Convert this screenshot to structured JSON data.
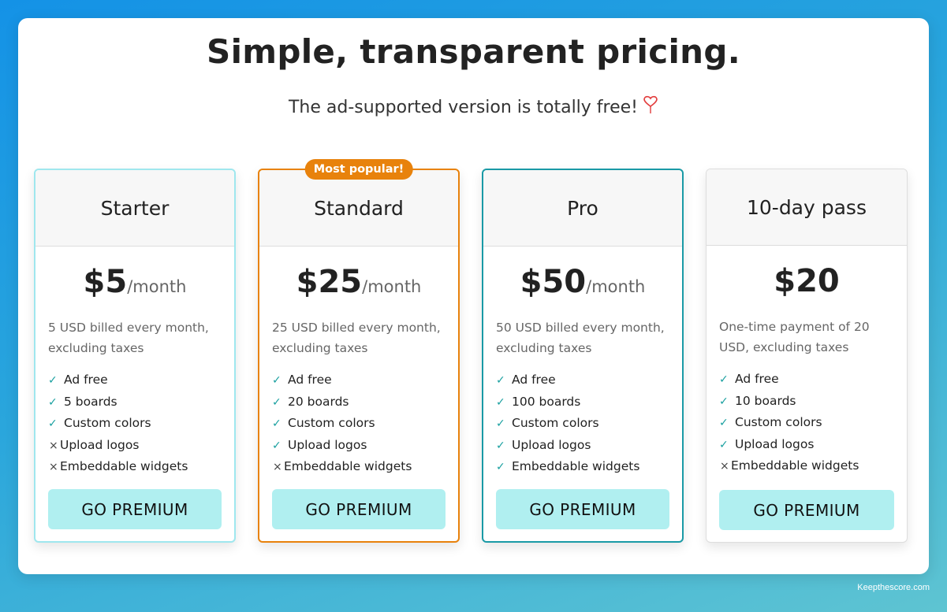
{
  "page": {
    "headline": "Simple, transparent pricing.",
    "subhead": "The ad-supported version is totally free!",
    "watermark": "Keepthescore.com"
  },
  "colors": {
    "starter_border": "#9fe7ee",
    "standard_border": "#e8820c",
    "pro_border": "#1a9aa6",
    "pass_border": "#dddddd",
    "button_bg": "#b0eff0",
    "check": "#1aa0a0",
    "heart": "#e23c3c"
  },
  "plans": [
    {
      "name": "Starter",
      "price": "$5",
      "period": "/month",
      "billing": "5 USD billed every month, excluding taxes",
      "badge": "",
      "features": [
        {
          "label": "Ad free",
          "included": true,
          "icon": "check-icon"
        },
        {
          "label": "5 boards",
          "included": true,
          "icon": "check-icon"
        },
        {
          "label": "Custom colors",
          "included": true,
          "icon": "check-icon"
        },
        {
          "label": "Upload logos",
          "included": false,
          "icon": "cross-icon"
        },
        {
          "label": "Embeddable widgets",
          "included": false,
          "icon": "cross-icon"
        }
      ],
      "cta": "GO PREMIUM"
    },
    {
      "name": "Standard",
      "price": "$25",
      "period": "/month",
      "billing": "25 USD billed every month, excluding taxes",
      "badge": "Most popular!",
      "features": [
        {
          "label": "Ad free",
          "included": true,
          "icon": "check-icon"
        },
        {
          "label": "20 boards",
          "included": true,
          "icon": "check-icon"
        },
        {
          "label": "Custom colors",
          "included": true,
          "icon": "check-icon"
        },
        {
          "label": "Upload logos",
          "included": true,
          "icon": "check-icon"
        },
        {
          "label": "Embeddable widgets",
          "included": false,
          "icon": "cross-icon"
        }
      ],
      "cta": "GO PREMIUM"
    },
    {
      "name": "Pro",
      "price": "$50",
      "period": "/month",
      "billing": "50 USD billed every month, excluding taxes",
      "badge": "",
      "features": [
        {
          "label": "Ad free",
          "included": true,
          "icon": "check-icon"
        },
        {
          "label": "100 boards",
          "included": true,
          "icon": "check-icon"
        },
        {
          "label": "Custom colors",
          "included": true,
          "icon": "check-icon"
        },
        {
          "label": "Upload logos",
          "included": true,
          "icon": "check-icon"
        },
        {
          "label": "Embeddable widgets",
          "included": true,
          "icon": "check-icon"
        }
      ],
      "cta": "GO PREMIUM"
    },
    {
      "name": "10-day pass",
      "price": "$20",
      "period": "",
      "billing": "One-time payment of 20 USD, excluding taxes",
      "badge": "",
      "features": [
        {
          "label": "Ad free",
          "included": true,
          "icon": "check-icon"
        },
        {
          "label": "10 boards",
          "included": true,
          "icon": "check-icon"
        },
        {
          "label": "Custom colors",
          "included": true,
          "icon": "check-icon"
        },
        {
          "label": "Upload logos",
          "included": true,
          "icon": "check-icon"
        },
        {
          "label": "Embeddable widgets",
          "included": false,
          "icon": "cross-icon"
        }
      ],
      "cta": "GO PREMIUM"
    }
  ]
}
